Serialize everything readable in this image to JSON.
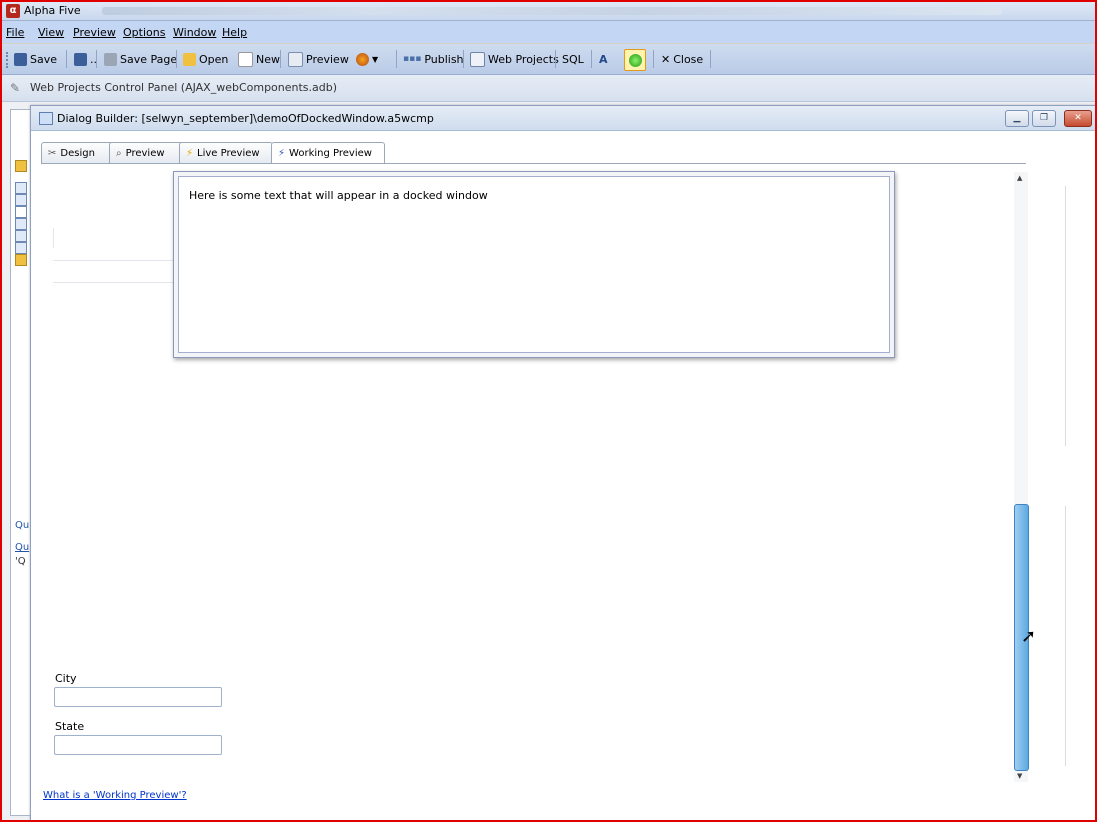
{
  "window": {
    "title": "Alpha Five"
  },
  "menu": {
    "items": [
      "File",
      "View",
      "Preview",
      "Options",
      "Window",
      "Help"
    ]
  },
  "toolbar": {
    "save": "Save",
    "save_page": "Save Page",
    "open": "Open",
    "new": "New",
    "preview": "Preview",
    "publish": "Publish",
    "web_projects": "Web Projects",
    "sql": "SQL",
    "close": "Close"
  },
  "control_panel": {
    "title": "Web Projects Control Panel (AJAX_webComponents.adb)"
  },
  "left_panel": {
    "texts": [
      "Qu",
      "Qu",
      "'Q"
    ]
  },
  "dialog": {
    "title": "Dialog Builder: [selwyn_september]\\demoOfDockedWindow.a5wcmp",
    "tabs": [
      "Design",
      "Preview",
      "Live Preview",
      "Working Preview"
    ],
    "active_tab": "Working Preview",
    "docked_text": "Here is some text that will appear in a docked window",
    "fields": [
      {
        "label": "City",
        "value": ""
      },
      {
        "label": "State",
        "value": ""
      }
    ],
    "help_link": "What is a 'Working Preview'?"
  },
  "icons": {
    "app": "alpha-five-icon",
    "firefox": "firefox-icon",
    "green_status": "green-status-icon"
  }
}
